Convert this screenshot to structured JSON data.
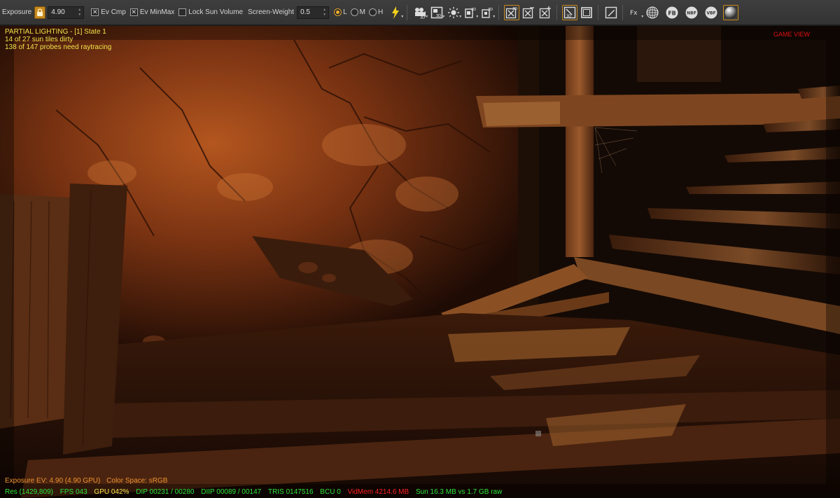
{
  "toolbar": {
    "exposure_label": "Exposure",
    "exposure_value": "4.90",
    "ev_cmp_label": "Ev Cmp",
    "ev_minmax_label": "Ev MinMax",
    "lock_sun_label": "Lock Sun Volume",
    "screen_weight_label": "Screen-Weight",
    "screen_weight_value": "0.5",
    "radio_l": "L",
    "radio_m": "M",
    "radio_h": "H",
    "btn_3d_a": "3D",
    "btn_3d_b": "3D",
    "btn_3d_c": "3D",
    "btn_3d_d": "3D",
    "btn_3d_e": "3D",
    "btn_3d_f": "3D",
    "btn_fx": "Fx",
    "btn_fb": "FB",
    "btn_nbf": "NBF",
    "btn_vbf": "VBF"
  },
  "hud": {
    "line1": "PARTIAL LIGHTING - [1] State 1",
    "line2": "14 of 27 sun tiles dirty",
    "line3": "138 of 147 probes need raytracing",
    "game_view": "GAME VIEW"
  },
  "status": {
    "exposure_ev": "Exposure EV: 4.90 (4.90 GPU)",
    "color_space": "Color Space: sRGB",
    "res": "Res (1429,809)",
    "fps": "FPS 043",
    "gpu": "GPU 042%",
    "dip": "DIP 00231 / 00280",
    "diip": "DIIP 00089 / 00147",
    "tris": "TRIS 0147516",
    "bcu": "BCU 0",
    "vidmem": "VidMem 4214.6 MB",
    "sun": "Sun 16.3 MB vs 1.7 GB raw"
  },
  "colors": {
    "accent": "#c98a1c",
    "hud_yellow": "#f3e24a",
    "status_green": "#2ee53a",
    "status_orange": "#f0932e",
    "status_red": "#ff2020",
    "status_yellow": "#f3e24a",
    "game_view_red": "#e01010"
  },
  "icons": [
    "lock-icon",
    "lightning-icon",
    "camera-3d-icon",
    "render-3d-icon",
    "sun-icon",
    "probe-3d-icon",
    "volume-3d-icon",
    "grid-3d-icon",
    "cross-icon",
    "add-icon",
    "viewport-3d-icon",
    "frame-icon",
    "edit-icon",
    "fx-icon",
    "mesh-sphere-icon",
    "fb-icon",
    "nbf-icon",
    "vbf-icon",
    "material-sphere-icon"
  ]
}
